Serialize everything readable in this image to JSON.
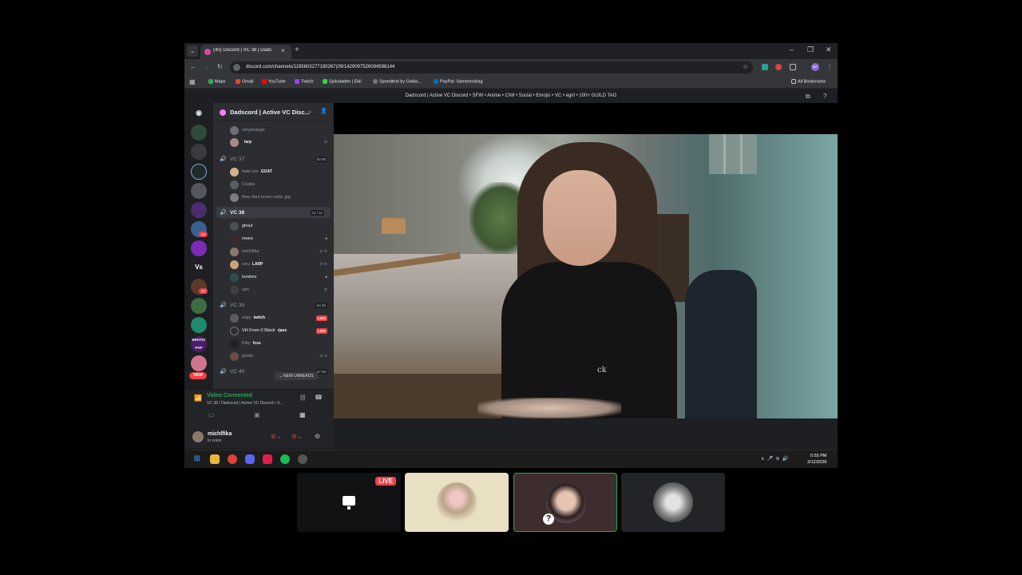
{
  "browser": {
    "tab_title": "(40) Discord | VC 38 | Dads",
    "url": "discord.com/channels/1195603277190267(09/1429097526094598144",
    "bookmarks": [
      "Maps",
      "Gmail",
      "YouTube",
      "Twitch",
      "Sjokoladen | Ekli",
      "Speedtest by Ookla...",
      "PayPal: Sammendrag"
    ],
    "all_bookmarks": "All Bookmarks",
    "profile_initials": "MP"
  },
  "discord": {
    "window_title": "Dadscord | Active VC Discord • SFW • Anime • Chill • Social • Emojis • VC • egirl • 100+ GUILD TAG",
    "guild_name": "Dadscord | Active VC Disc...",
    "rail": {
      "vs_label": "Vs",
      "erotic_label": "EROTIC PVP",
      "badge_20": "20",
      "badge_37": "37",
      "new_label": "NEW"
    },
    "channels": {
      "top_users": [
        {
          "name": "verystrange"
        },
        {
          "name": "",
          "tag": "larp"
        }
      ],
      "vc37": {
        "name": "VC 37",
        "count": "03 06",
        "users": [
          {
            "name": "bald unc",
            "tag": "GOAT"
          },
          {
            "name": "Csaba"
          },
          {
            "name": "they dont know nada .jpp"
          }
        ]
      },
      "vc38": {
        "name": "VC 38",
        "count": "41 / 11",
        "users": [
          {
            "name": "ghoul"
          },
          {
            "name": "meee"
          },
          {
            "name": "michlfika"
          },
          {
            "name": "ruru",
            "tag": "LARP"
          },
          {
            "name": "tundres"
          },
          {
            "name": "vpn"
          }
        ]
      },
      "vc39": {
        "name": "VC 39",
        "count": "04 06",
        "users": [
          {
            "name": "expy",
            "tag": "twitch",
            "live": "LIVE"
          },
          {
            "name": "VH From 0 Black",
            "tag": "rjaes",
            "live": "LIVE"
          },
          {
            "name": "Kitty",
            "tag": "fcss"
          },
          {
            "name": "pickle"
          }
        ]
      },
      "vc40": {
        "name": "VC 40",
        "count": "07 06"
      },
      "new_unreads": "NEW UNREADS"
    },
    "voice": {
      "status": "Video Connected",
      "location": "VC 38 / Dadscord | Active VC Discord • S..."
    },
    "me": {
      "name": "michlfika",
      "status": "In voice"
    }
  },
  "taskbar": {
    "time": "5:55 PM",
    "date": "3/12/2026"
  },
  "tiles": {
    "live_label": "LIVE",
    "help_icon": "?"
  },
  "colors": {
    "discord_green": "#23a55a",
    "live_red": "#f23f43",
    "blurple": "#5865f2"
  }
}
